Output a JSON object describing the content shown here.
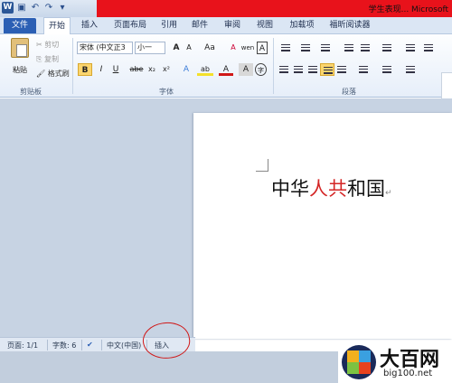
{
  "window": {
    "title": "学生表现... Microsoft"
  },
  "tabs": [
    "文件",
    "开始",
    "插入",
    "页面布局",
    "引用",
    "邮件",
    "审阅",
    "视图",
    "加载项",
    "福昕阅读器"
  ],
  "clipboard": {
    "paste": "粘贴",
    "cut": "剪切",
    "copy": "复制",
    "format_painter": "格式刷",
    "group": "剪贴板"
  },
  "font": {
    "name": "宋体 (中文正3",
    "size": "小一",
    "bold": "B",
    "italic": "I",
    "underline": "U",
    "strike": "abe",
    "sub": "x₂",
    "sup": "x²",
    "grow": "A",
    "shrink": "A",
    "case": "Aa",
    "clear": "A",
    "phonetic": "wen",
    "border_char": "A",
    "effects": "A",
    "highlight": "ab",
    "color": "A",
    "enclosed": "字",
    "group": "字体"
  },
  "paragraph": {
    "group": "段落"
  },
  "document": {
    "text_a": "中华",
    "text_red": "人共",
    "text_b": "和国",
    "mark": "↵"
  },
  "status": {
    "page": "页面: 1/1",
    "words": "字数: 6",
    "lang": "中文(中国)",
    "mode": "插入"
  },
  "watermark": {
    "brand": "大百网",
    "url": "big100.net"
  },
  "colors": {
    "accent": "#2b5fb4",
    "title_red": "#e8121b",
    "highlight": "#fbd56e",
    "ink_red": "#d01818"
  }
}
